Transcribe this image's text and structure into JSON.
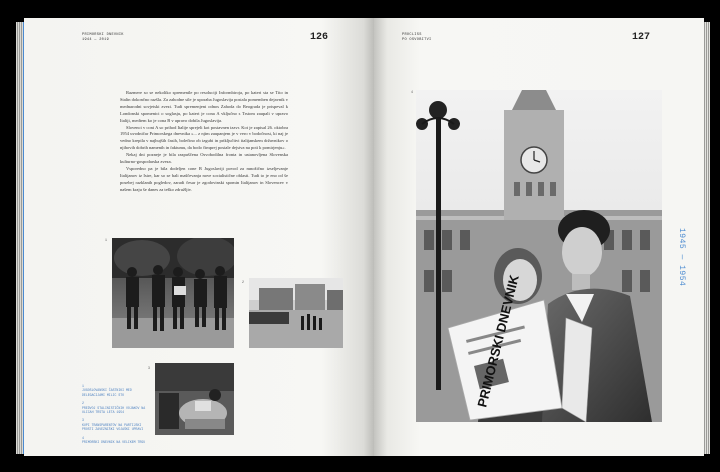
{
  "left_page": {
    "running_head_title": "PRIMORSKI DNEVNIK",
    "running_head_years": "1944 — 2019",
    "page_number": "126",
    "paragraphs": [
      "Razmere so se nekoliko spremenile po resoluciji Informbiroja, po kateri sta se Tito in Stalin dokončno razšla. Za zahodne sile je uporaba Jugoslavija postala pomemben dejavnik v mednarodni sovjetski zvezi. Tudi spremenjeni odnos Zahoda do Beograda je prispeval k Londonski spomenici o soglasju, po kateri je cona A vključno s Trstom zaupali v upravo Italiji, medtem ko je cona B v upravo dobila Jugoslavija.",
      "Slovenci v coni A so prihod Italije sprejeli kot postavnen izzvr. Kot je zapisal 26. oktobra 1954 uvodničar Primorskega dnevnika »... z njim zaupanjem je v vero v bodočnost, ki naj je vedno krepila v najhujših časih, bolečino ob izgubi in priključitvi italijanskem državnikov o njihovih dobrih namenih in faktumu, da bodo čimprej postale dejstva na poti k pomirjenju«.",
      "Nekaj dni pozneje je bila razpuščena Osvobodilna fronta in ustanovljena Slovenska kulturno-gospodarska zveza.",
      "Vsporedno pa je bila dodeljen cone B Jugoslaviji povod za množično izseljevanje Italijanov iz Istre, kar so se bali maščevanja nove socialistične oblasti. Tudi to je eno od še posebej razklanih pogledov, zaradi česar je zgodovinski spomin Italijanov in Slovencev v našem kraju še danes za teško združljiv."
    ],
    "figure_numbers": [
      "1",
      "2",
      "3"
    ],
    "captions": [
      {
        "num": "1",
        "text": "JUGOSLOVANSKI ČASTNIKI MED DELEGACIJAMI MILIC STO"
      },
      {
        "num": "2",
        "text": "PREDVOJ STALINISTIČNIH VOJAKOV NA ULICAH TRSTA LETA 1954"
      },
      {
        "num": "3",
        "text": "KUPI TRANSPARENTOV NA PARTIJSKI PROSTI ZAVEZNIŠKI VOJAŠKI UPRAVI"
      },
      {
        "num": "4",
        "text": "PRIMORSKI DNEVNIK NA VELIKEM TRGU"
      }
    ]
  },
  "right_page": {
    "running_head_line1": "PROCLISS",
    "running_head_line2": "PO OSVOBITVI",
    "page_number": "127",
    "figure_number": "4",
    "side_years": "1945 — 1954",
    "newspaper_masthead": "PRIMORSKI DNEVNIK"
  }
}
